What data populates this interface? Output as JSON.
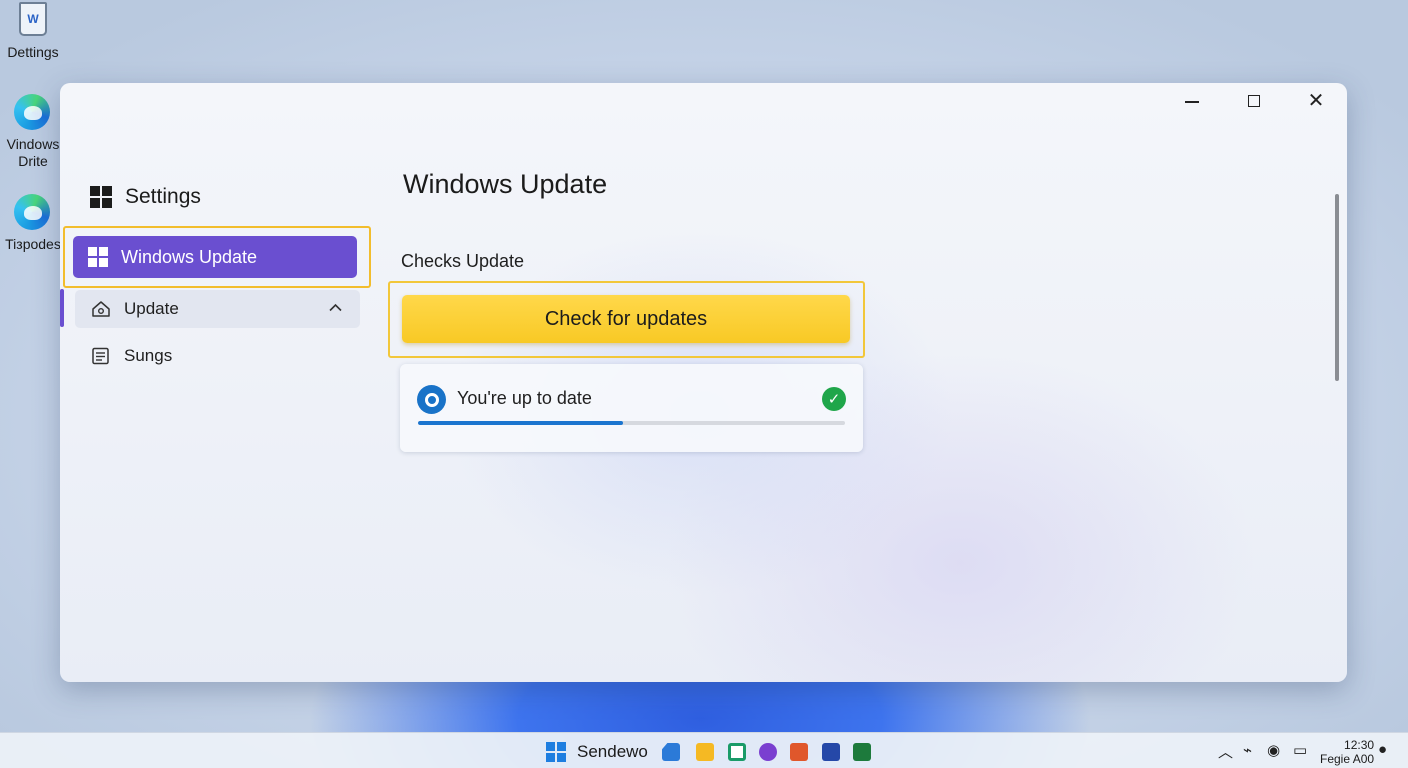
{
  "desktop": {
    "icons": [
      {
        "label": "Dettings"
      },
      {
        "label": "Vindows Drite"
      },
      {
        "label": "Tiзpodes"
      }
    ],
    "bin_glyph_text": "W"
  },
  "window": {
    "app_title": "Settings",
    "controls": {
      "minimize": "minimize-icon",
      "maximize": "maximize-icon",
      "close": "close-icon"
    },
    "sidebar": {
      "selected": {
        "label": "Windows Update",
        "icon": "windows-logo-icon"
      },
      "items": [
        {
          "label": "Update",
          "icon": "home-icon",
          "chevron": "chevron-up-icon"
        },
        {
          "label": "Sungs",
          "icon": "document-icon"
        }
      ]
    },
    "main": {
      "title": "Windows Update",
      "section_label": "Checks Update",
      "check_button_label": "Check for updates",
      "status": {
        "text": "You're up to date",
        "progress": 0.48,
        "ok_icon": "check-circle-icon"
      }
    }
  },
  "taskbar": {
    "start_label": "Sendewo",
    "apps": [
      "store-icon",
      "folder-icon",
      "calendar-icon",
      "media-icon",
      "office-icon",
      "photos-icon",
      "xbox-icon"
    ],
    "tray": [
      "chevron-up-icon",
      "network-icon",
      "volume-icon",
      "battery-icon",
      "notification-icon"
    ],
    "clock_time": "12:30",
    "clock_sub": "Fegie A00"
  },
  "colors": {
    "accent_purple": "#6a4fd0",
    "highlight_yellow": "#f2bd2d",
    "button_yellow": "#f8c925",
    "success_green": "#1fa64a",
    "progress_blue": "#1b75cf"
  }
}
